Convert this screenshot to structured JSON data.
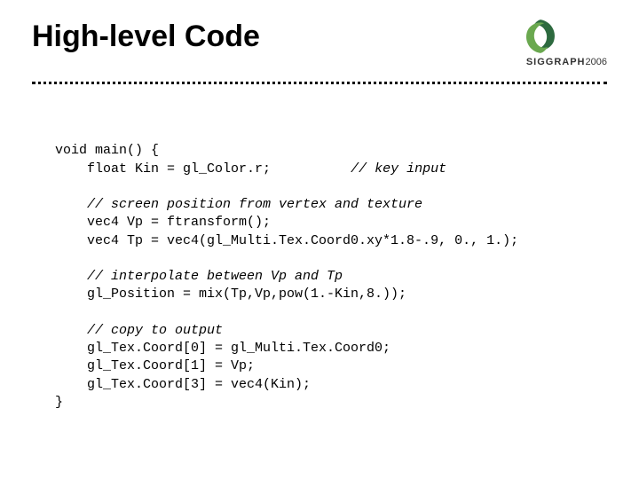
{
  "title": "High-level Code",
  "logo": {
    "wordmark": "SIGGRAPH",
    "year": "2006"
  },
  "code": {
    "l1": "void main() {",
    "l2_a": "float Kin = gl_Color.r;",
    "l2_b": "// key input",
    "l3": "// screen position from vertex and texture",
    "l4": "vec4 Vp = ftransform();",
    "l5": "vec4 Tp = vec4(gl_Multi.Tex.Coord0.xy*1.8-.9, 0., 1.);",
    "l6": "// interpolate between Vp and Tp",
    "l7": "gl_Position = mix(Tp,Vp,pow(1.-Kin,8.));",
    "l8": "// copy to output",
    "l9": "gl_Tex.Coord[0] = gl_Multi.Tex.Coord0;",
    "l10": "gl_Tex.Coord[1] = Vp;",
    "l11": "gl_Tex.Coord[3] = vec4(Kin);",
    "l12": "}"
  }
}
